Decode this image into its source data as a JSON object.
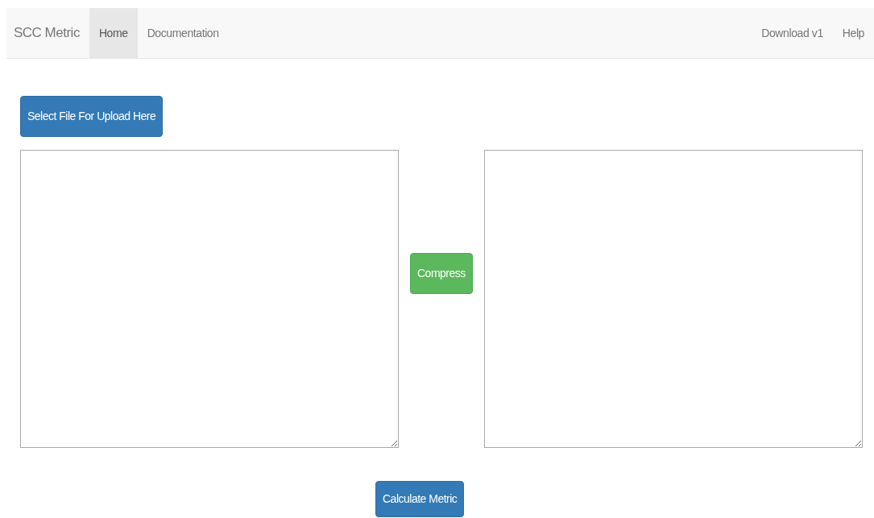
{
  "navbar": {
    "brand": "SCC Metric",
    "left_items": [
      {
        "label": "Home",
        "selected": true
      },
      {
        "label": "Documentation",
        "selected": false
      }
    ],
    "right_items": [
      {
        "label": "Download v1",
        "selected": false
      },
      {
        "label": "Help",
        "selected": false
      }
    ]
  },
  "upload_button": "Select File For Upload Here",
  "compress_button": "Compress",
  "calculate_button": "Calculate Metric"
}
